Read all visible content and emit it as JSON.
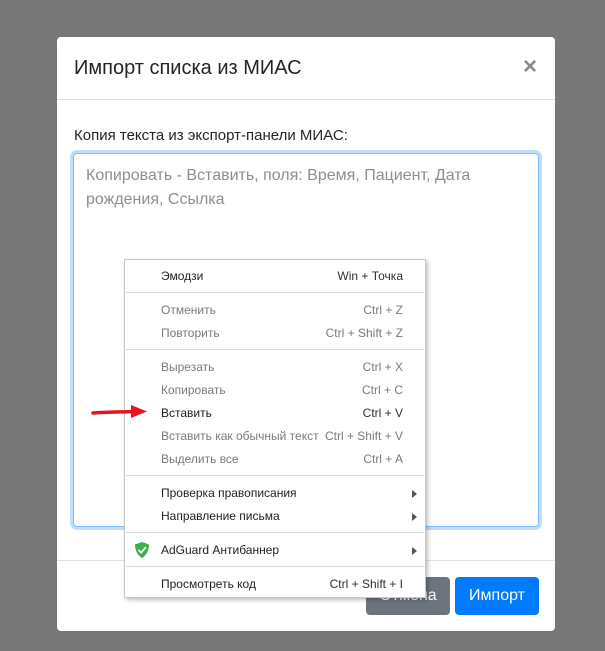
{
  "modal": {
    "title": "Импорт списка из МИАС",
    "close_symbol": "×",
    "field_label": "Копия текста из экспорт-панели МИАС:",
    "textarea_placeholder": "Копировать - Вставить, поля: Время, Пациент, Дата рождения, Ссылка",
    "cancel_label": "Отмена",
    "import_label": "Импорт"
  },
  "context_menu": {
    "emoji": {
      "label": "Эмодзи",
      "shortcut": "Win + Точка"
    },
    "undo": {
      "label": "Отменить",
      "shortcut": "Ctrl + Z"
    },
    "redo": {
      "label": "Повторить",
      "shortcut": "Ctrl + Shift + Z"
    },
    "cut": {
      "label": "Вырезать",
      "shortcut": "Ctrl + X"
    },
    "copy": {
      "label": "Копировать",
      "shortcut": "Ctrl + C"
    },
    "paste": {
      "label": "Вставить",
      "shortcut": "Ctrl + V"
    },
    "paste_plain": {
      "label": "Вставить как обычный текст",
      "shortcut": "Ctrl + Shift + V"
    },
    "select_all": {
      "label": "Выделить все",
      "shortcut": "Ctrl + A"
    },
    "spellcheck": {
      "label": "Проверка правописания"
    },
    "writing_direction": {
      "label": "Направление письма"
    },
    "adguard": {
      "label": "AdGuard Антибаннер"
    },
    "inspect": {
      "label": "Просмотреть код",
      "shortcut": "Ctrl + Shift + I"
    }
  },
  "colors": {
    "backdrop": "#777777",
    "primary": "#007bff",
    "secondary": "#6c757d",
    "annotation_arrow": "#e8141c",
    "adguard_green": "#3cb04a"
  }
}
